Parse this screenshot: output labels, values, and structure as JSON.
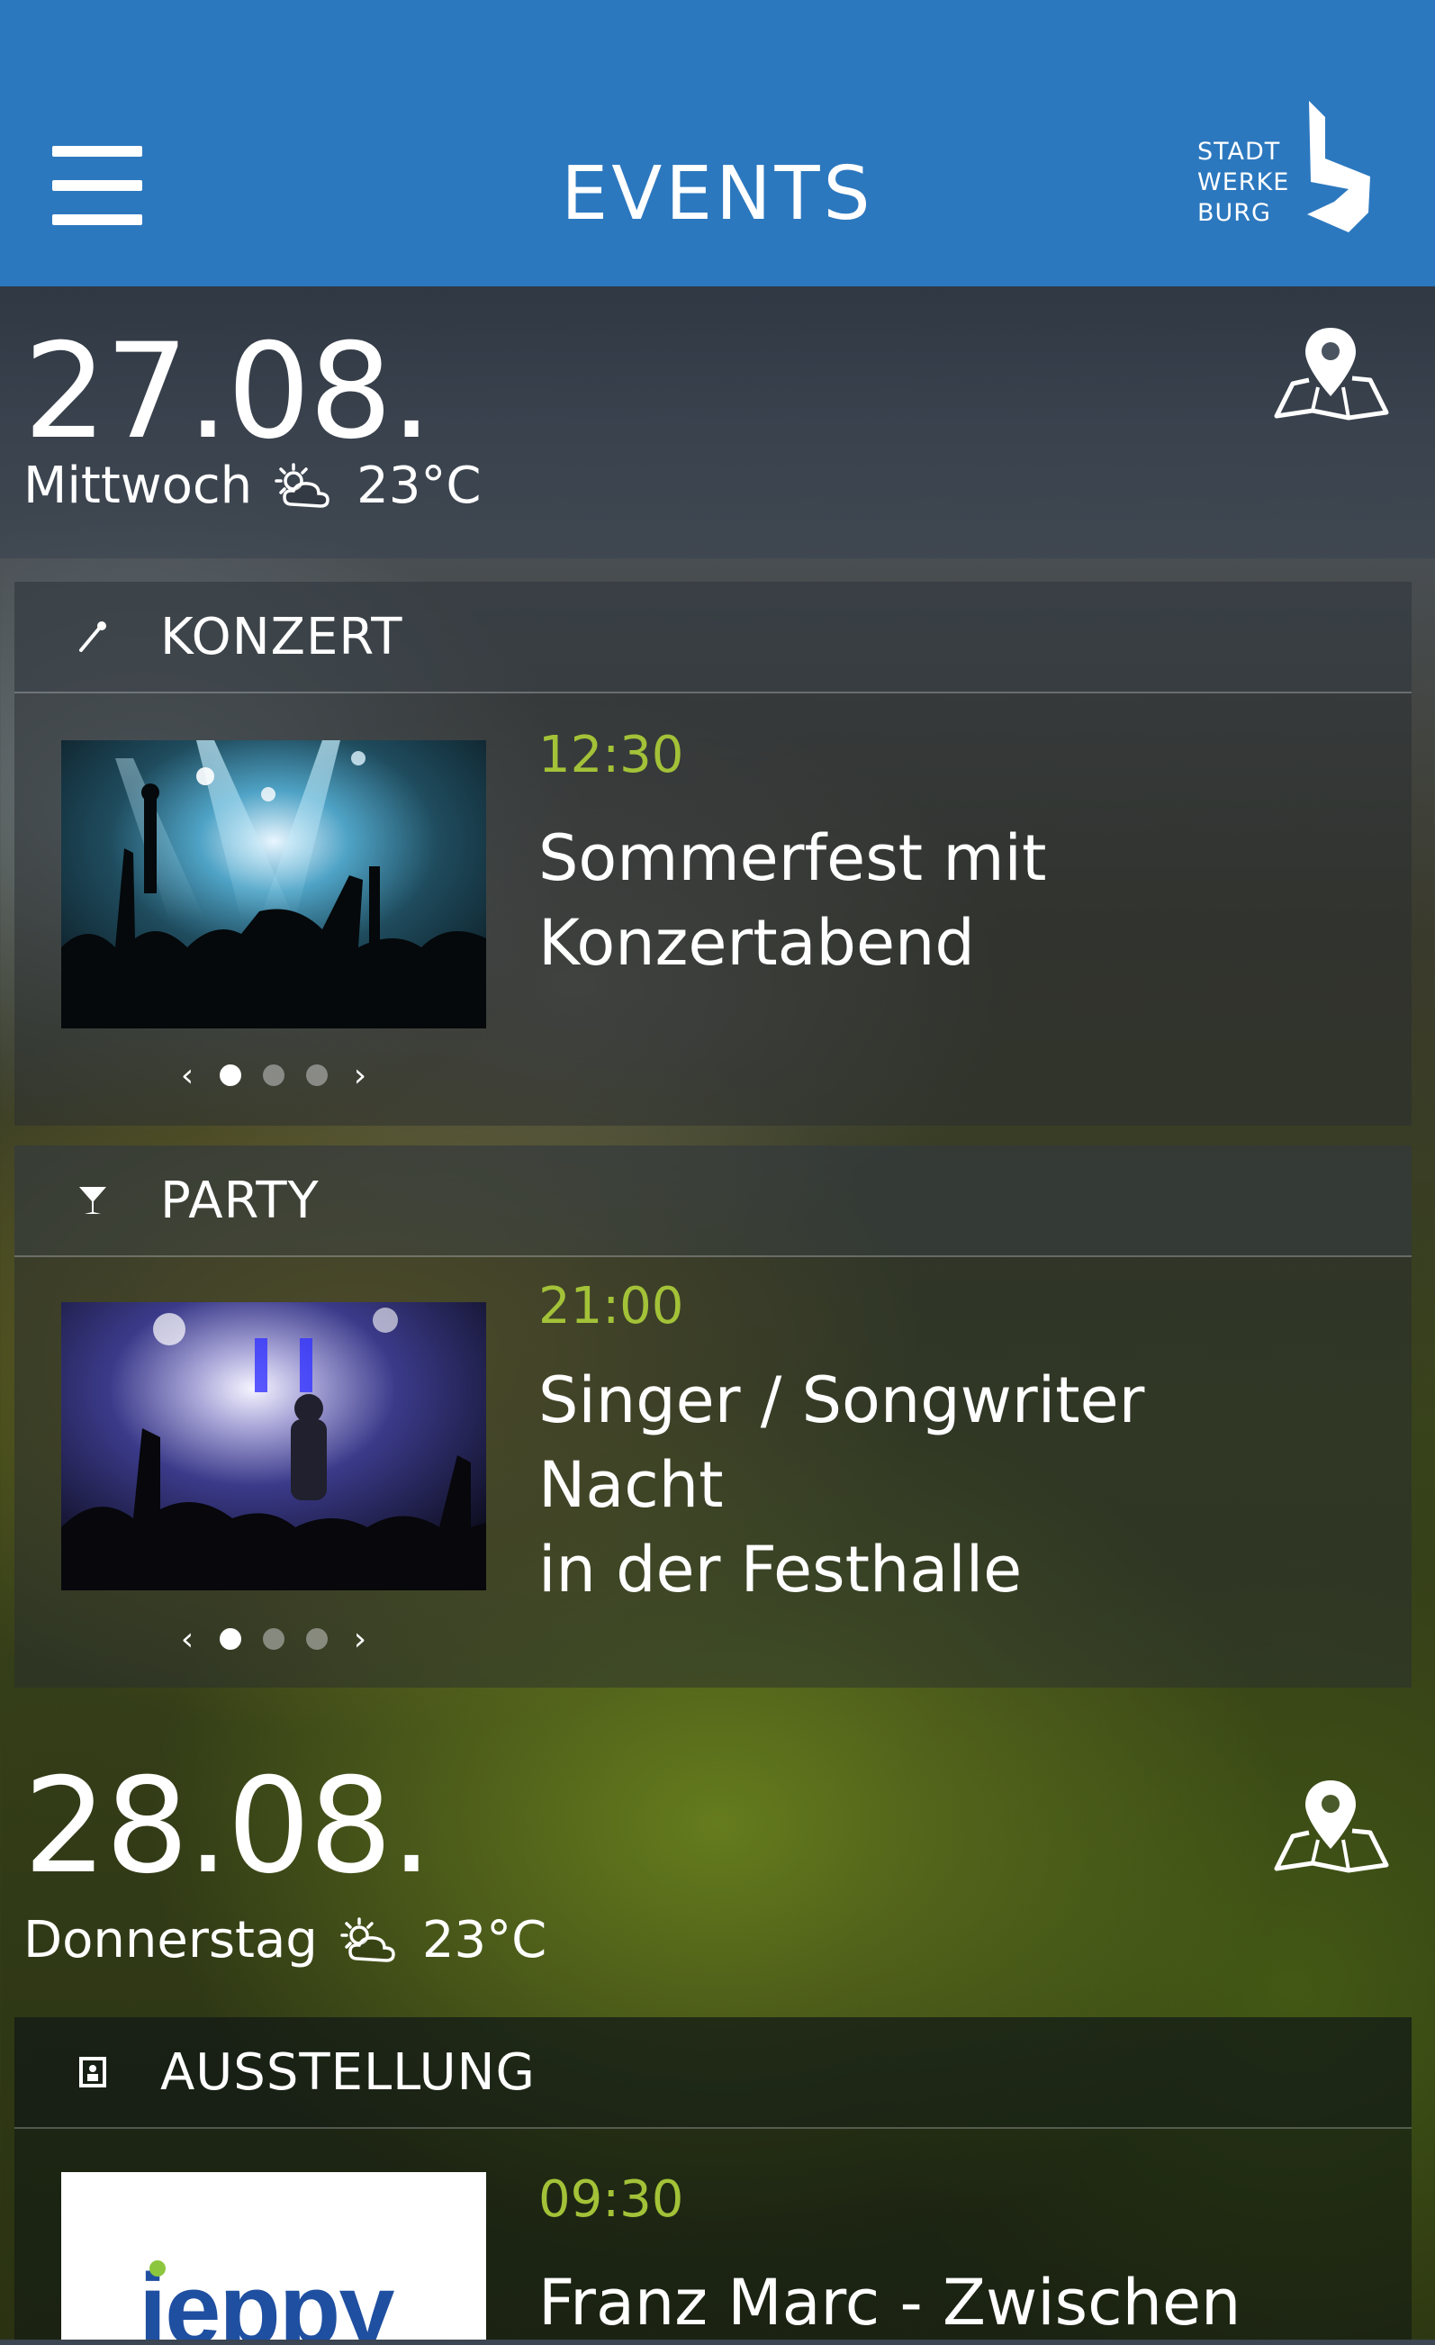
{
  "header": {
    "title": "EVENTS",
    "logo_lines": [
      "STADT",
      "WERKE",
      "BURG"
    ],
    "background_color": "#2c78bf"
  },
  "days": [
    {
      "date": "27.08.",
      "weekday": "Mittwoch",
      "temperature": "23°C",
      "weather_icon": "partly-cloudy-icon",
      "map_icon": "map-pin-icon",
      "events": [
        {
          "category": "KONZERT",
          "category_icon": "microphone-icon",
          "time": "12:30",
          "title_lines": [
            "Sommerfest mit",
            "Konzertabend"
          ],
          "image": "concert-crowd-photo",
          "slide_count": 3,
          "active_slide": 1
        },
        {
          "category": "PARTY",
          "category_icon": "cocktail-icon",
          "time": "21:00",
          "title_lines": [
            "Singer / Songwriter Nacht",
            "in der Festhalle"
          ],
          "image": "singer-stage-photo",
          "slide_count": 3,
          "active_slide": 1
        }
      ]
    },
    {
      "date": "28.08.",
      "weekday": "Donnerstag",
      "temperature": "23°C",
      "weather_icon": "partly-cloudy-icon",
      "map_icon": "map-pin-icon",
      "events": [
        {
          "category": "AUSSTELLUNG",
          "category_icon": "exhibition-icon",
          "time": "09:30",
          "title_lines": [
            "Franz Marc - Zwischen"
          ],
          "image": "jeppy-logo",
          "image_text": "jeppy"
        }
      ]
    }
  ],
  "pager": {
    "prev": "‹",
    "next": "›"
  },
  "colors": {
    "accent_green": "#a3c238"
  }
}
